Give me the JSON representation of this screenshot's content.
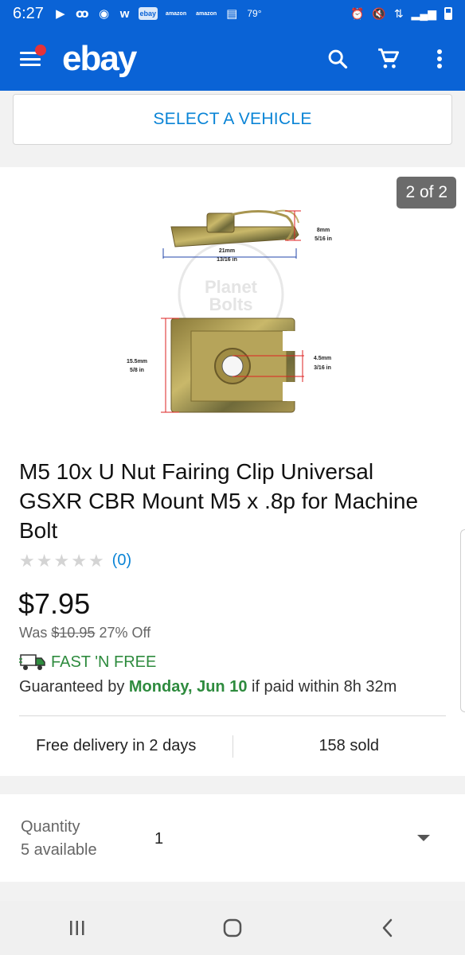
{
  "status_bar": {
    "time": "6:27",
    "notifications": [
      "youtube-icon",
      "voicemail-icon",
      "chrome-icon",
      "w-icon",
      "ebay-notif-icon",
      "amazon-icon",
      "amazon-icon",
      "calendar-icon"
    ],
    "ebay_notif_text": "ebay",
    "amazon_text": "amazon",
    "temperature": "79°"
  },
  "app_bar": {
    "logo": "ebay"
  },
  "vehicle": {
    "select_label": "SELECT A VEHICLE"
  },
  "product": {
    "image_counter": "2 of 2",
    "image_labels": {
      "dim_top_height_mm": "8mm",
      "dim_top_height_in": "5/16 in",
      "dim_width_mm": "21mm",
      "dim_width_in": "13/16 in",
      "dim_height_mm": "15.5mm",
      "dim_height_in": "5/8 in",
      "dim_hole_mm": "4.5mm",
      "dim_hole_in": "3/16 in",
      "watermark": "Planet Bolts"
    },
    "title": "M5 10x U Nut Fairing Clip Universal GSXR CBR Mount M5 x .8p for Machine Bolt",
    "rating_stars": 0,
    "rating_count": "(0)",
    "price": "$7.95",
    "was_label": "Was",
    "was_price": "$10.95",
    "discount": "27% Off",
    "shipping_label": "FAST 'N FREE",
    "guarantee_prefix": "Guaranteed by",
    "guarantee_date": "Monday, Jun 10",
    "guarantee_suffix": "if paid within 8h 32m",
    "delivery": "Free delivery in 2 days",
    "sold": "158 sold"
  },
  "quantity": {
    "label": "Quantity",
    "available": "5 available",
    "value": "1"
  },
  "colors": {
    "brand_blue": "#0a63d6",
    "link_blue": "#0a84d6",
    "green": "#2e8b3e",
    "logo_dot": "#e53238"
  }
}
